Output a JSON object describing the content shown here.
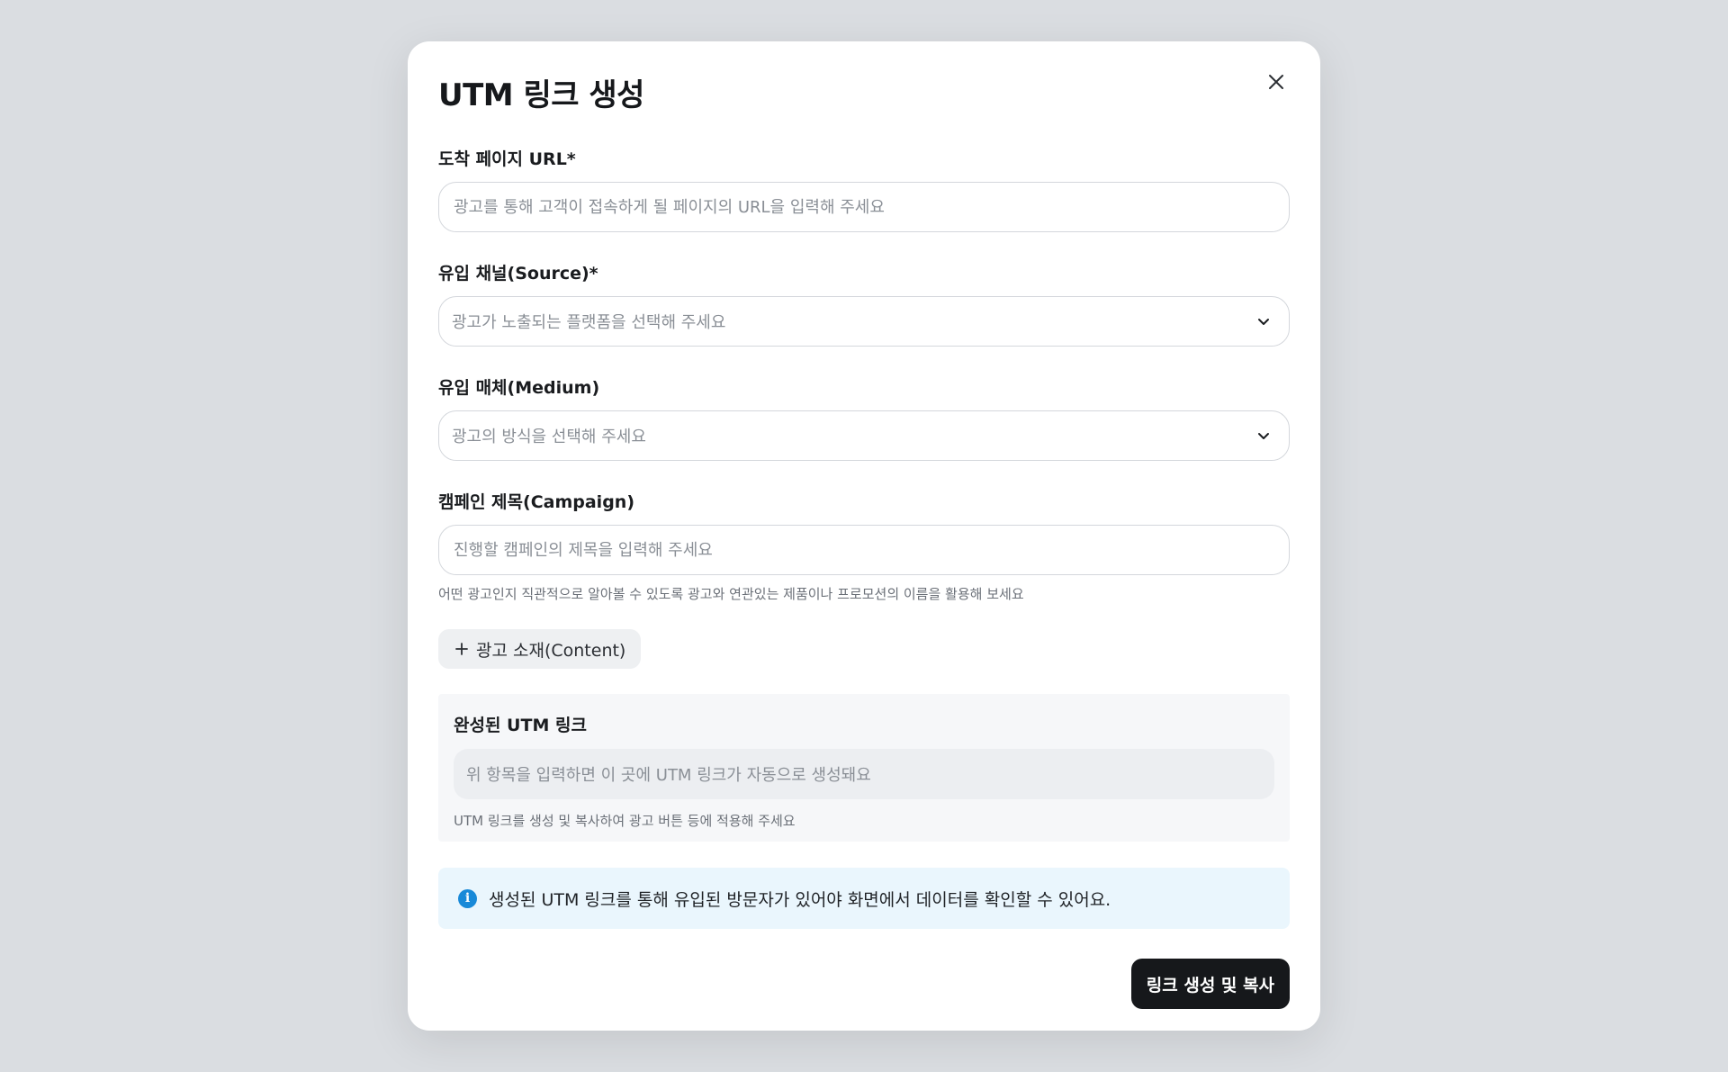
{
  "modal": {
    "title": "UTM 링크 생성",
    "close_icon": "close-icon"
  },
  "fields": {
    "url": {
      "label": "도착 페이지 URL*",
      "placeholder": "광고를 통해 고객이 접속하게 될 페이지의 URL을 입력해 주세요",
      "value": ""
    },
    "source": {
      "label": "유입 채널(Source)*",
      "placeholder": "광고가 노출되는 플랫폼을 선택해 주세요",
      "icon": "chevron-down-icon"
    },
    "medium": {
      "label": "유입 매체(Medium)",
      "placeholder": "광고의 방식을 선택해 주세요",
      "icon": "chevron-down-icon"
    },
    "campaign": {
      "label": "캠페인 제목(Campaign)",
      "placeholder": "진행할 캠페인의 제목을 입력해 주세요",
      "value": "",
      "helper": "어떤 광고인지 직관적으로 알아볼 수 있도록 광고와 연관있는 제품이나 프로모션의 이름을 활용해 보세요"
    }
  },
  "add_content": {
    "label": "광고 소재(Content)",
    "icon": "plus-icon"
  },
  "result": {
    "title": "완성된 UTM 링크",
    "placeholder": "위 항목을 입력하면 이 곳에 UTM 링크가 자동으로 생성돼요",
    "helper": "UTM 링크를 생성 및 복사하여 광고 버튼 등에 적용해 주세요"
  },
  "info": {
    "icon": "info-icon",
    "text": "생성된 UTM 링크를 통해 유입된 방문자가 있어야 화면에서 데이터를 확인할 수 있어요."
  },
  "actions": {
    "submit_label": "링크 생성 및 복사"
  },
  "colors": {
    "primary": "#16181b",
    "info_bg": "#eaf6fd",
    "info_icon": "#1889d8",
    "page_bg": "#dadde1"
  }
}
